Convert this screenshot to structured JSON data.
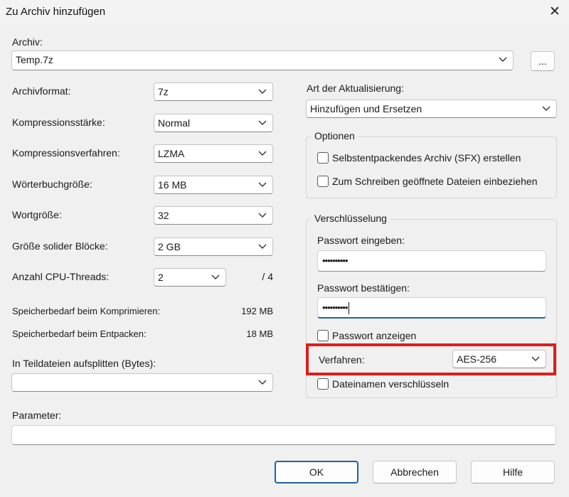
{
  "window": {
    "title": "Zu Archiv hinzufügen",
    "close_glyph": "✕"
  },
  "archive": {
    "label": "Archiv:",
    "value": "Temp.7z",
    "browse_label": "..."
  },
  "left": {
    "format": {
      "label": "Archivformat:",
      "value": "7z"
    },
    "level": {
      "label": "Kompressionsstärke:",
      "value": "Normal"
    },
    "method": {
      "label": "Kompressionsverfahren:",
      "value": "LZMA"
    },
    "dict": {
      "label": "Wörterbuchgröße:",
      "value": "16 MB"
    },
    "word": {
      "label": "Wortgröße:",
      "value": "32"
    },
    "solid": {
      "label": "Größe solider Blöcke:",
      "value": "2 GB"
    },
    "threads": {
      "label": "Anzahl CPU-Threads:",
      "value": "2",
      "max": "/ 4"
    },
    "mem_compress": {
      "label": "Speicherbedarf beim Komprimieren:",
      "value": "192 MB"
    },
    "mem_extract": {
      "label": "Speicherbedarf beim Entpacken:",
      "value": "18 MB"
    },
    "split": {
      "label": "In Teildateien aufsplitten (Bytes):",
      "value": ""
    },
    "params": {
      "label": "Parameter:",
      "value": ""
    }
  },
  "right": {
    "update": {
      "label": "Art der Aktualisierung:",
      "value": "Hinzufügen und Ersetzen"
    },
    "options": {
      "title": "Optionen",
      "sfx": "Selbstentpackendes Archiv (SFX) erstellen",
      "shared": "Zum Schreiben geöffnete Dateien einbeziehen"
    },
    "encryption": {
      "title": "Verschlüsselung",
      "pw_label": "Passwort eingeben:",
      "pw_value": "••••••••••",
      "confirm_label": "Passwort bestätigen:",
      "confirm_value": "••••••••••",
      "show_pw": "Passwort anzeigen",
      "method_label": "Verfahren:",
      "method_value": "AES-256",
      "encrypt_names": "Dateinamen verschlüsseln"
    }
  },
  "buttons": {
    "ok": "OK",
    "cancel": "Abbrechen",
    "help": "Hilfe"
  },
  "colors": {
    "highlight": "#e01c1c",
    "focus": "#1f5fa8"
  }
}
